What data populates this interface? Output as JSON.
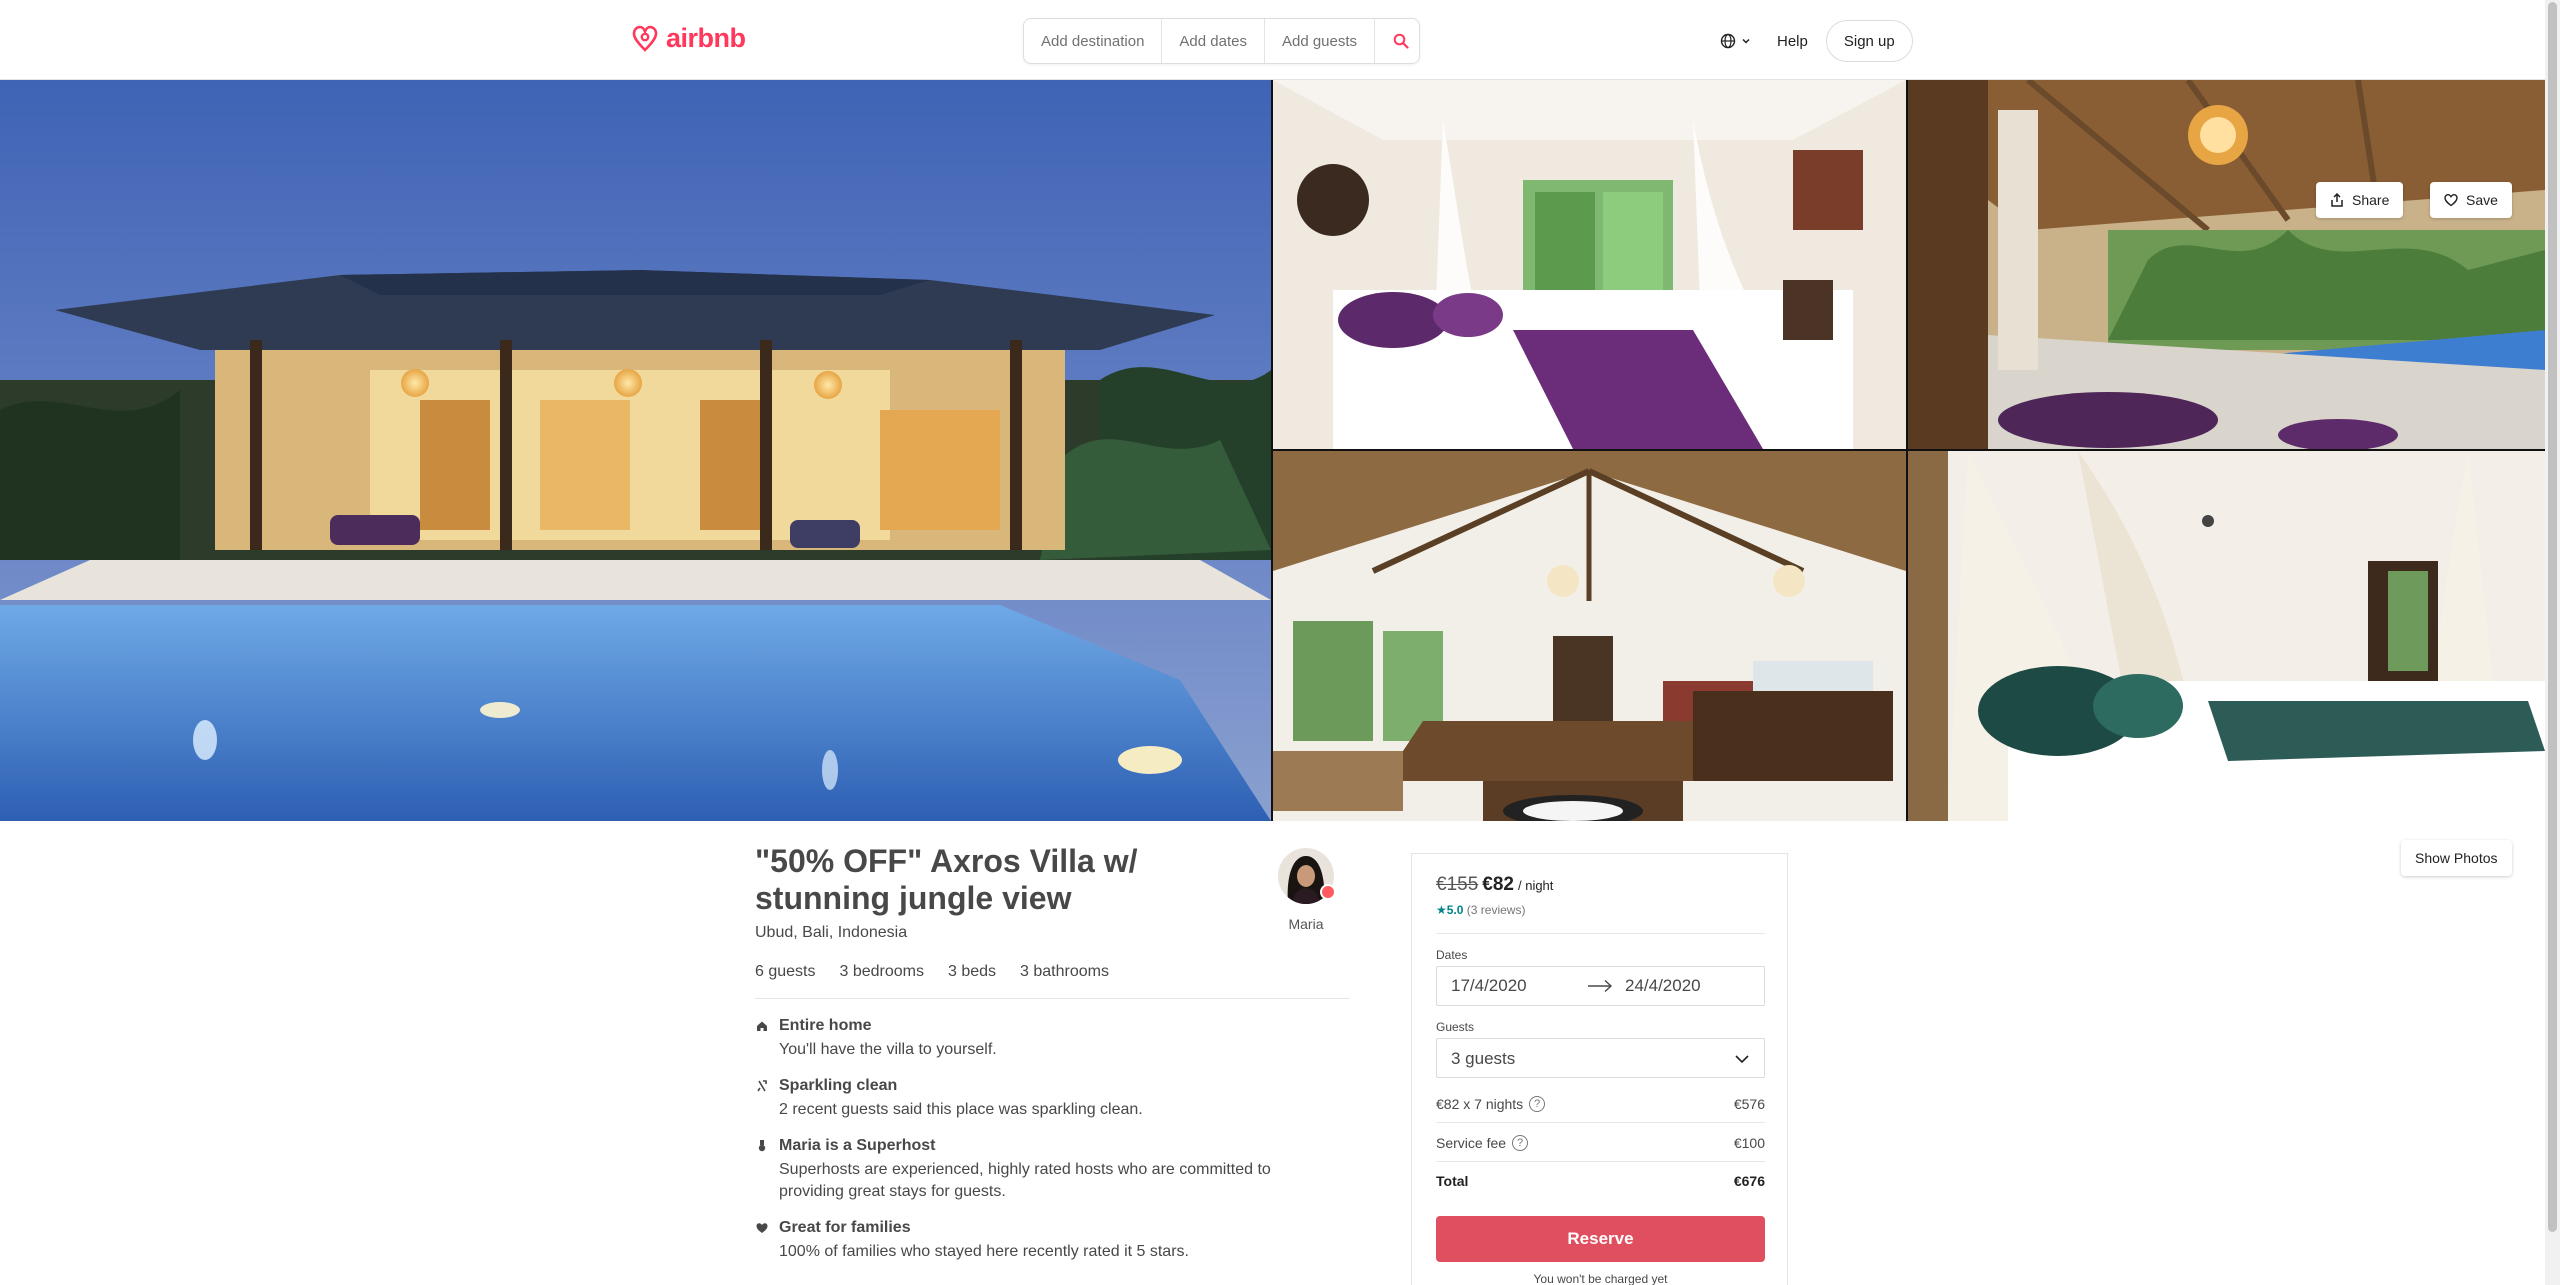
{
  "header": {
    "logo_text": "airbnb",
    "search": {
      "destination": "Add destination",
      "dates": "Add dates",
      "guests": "Add guests"
    },
    "help": "Help",
    "signup": "Sign up"
  },
  "gallery": {
    "share": "Share",
    "save": "Save",
    "show_photos": "Show Photos"
  },
  "listing": {
    "title": "\"50% OFF\" Axros Villa w/ stunning jungle view",
    "location": "Ubud, Bali, Indonesia",
    "host_name": "Maria",
    "stats": [
      "6 guests",
      "3 bedrooms",
      "3 beds",
      "3 bathrooms"
    ],
    "features": [
      {
        "icon": "home-icon",
        "title": "Entire home",
        "desc": "You'll have the villa to yourself."
      },
      {
        "icon": "sparkle-icon",
        "title": "Sparkling clean",
        "desc": "2 recent guests said this place was sparkling clean."
      },
      {
        "icon": "medal-icon",
        "title": "Maria is a Superhost",
        "desc": "Superhosts are experienced, highly rated hosts who are committed to providing great stays for guests."
      },
      {
        "icon": "heart-icon",
        "title": "Great for families",
        "desc": "100% of families who stayed here recently rated it 5 stars."
      }
    ]
  },
  "booking": {
    "old_price": "€155",
    "new_price": "€82",
    "per_night": "/ night",
    "rating_value": "★5.0",
    "rating_reviews": "(3 reviews)",
    "dates_label": "Dates",
    "check_in": "17/4/2020",
    "check_out": "24/4/2020",
    "guests_label": "Guests",
    "guests_value": "3 guests",
    "nights_label": "€82 x 7 nights",
    "nights_amount": "€576",
    "fee_label": "Service fee",
    "fee_amount": "€100",
    "total_label": "Total",
    "total_amount": "€676",
    "reserve": "Reserve",
    "no_charge": "You won't be charged yet"
  },
  "colors": {
    "brand": "#ff385c",
    "reserve": "#e04f5f",
    "rating": "#008489"
  }
}
